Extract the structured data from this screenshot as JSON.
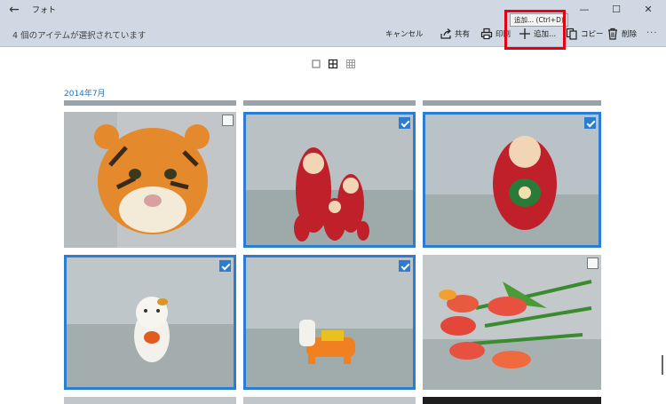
{
  "window": {
    "title": "フォト",
    "back_glyph": "←",
    "minimize_glyph": "—",
    "maximize_glyph": "☐",
    "close_glyph": "✕"
  },
  "commandbar": {
    "selection_status": "4 個のアイテムが選択されています",
    "cancel_label": "キャンセル",
    "share_label": "共有",
    "print_label": "印刷",
    "add_label": "追加...",
    "copy_label": "コピー",
    "delete_label": "削除",
    "more_label": "···"
  },
  "tooltip": {
    "text": "追加... (Ctrl+D)"
  },
  "gallery": {
    "date_header": "2014年7月",
    "items": [
      {
        "subject": "tiger-plush",
        "selected": false
      },
      {
        "subject": "matryoshka-set",
        "selected": true
      },
      {
        "subject": "matryoshka-single",
        "selected": true
      },
      {
        "subject": "lucky-cat",
        "selected": true
      },
      {
        "subject": "toy-horse",
        "selected": true
      },
      {
        "subject": "tulips",
        "selected": false
      }
    ]
  },
  "colors": {
    "accent": "#2b7cd3",
    "highlight": "#e60012",
    "chrome": "#cfd8e3"
  }
}
